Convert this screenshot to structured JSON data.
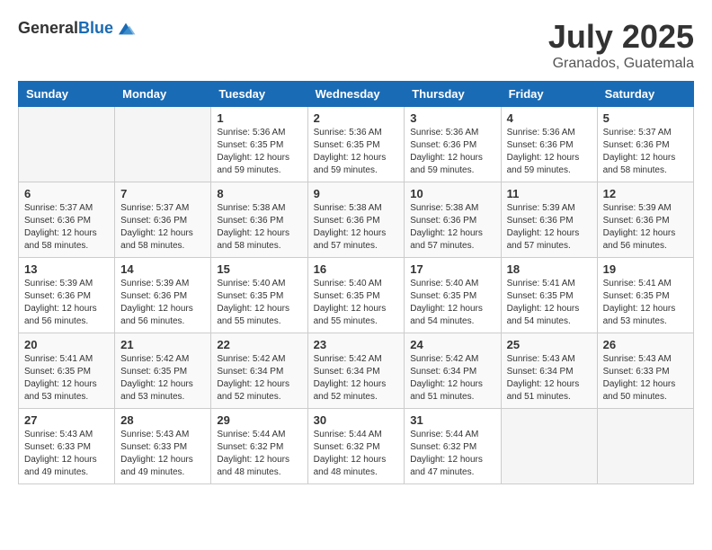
{
  "header": {
    "logo_general": "General",
    "logo_blue": "Blue",
    "month_title": "July 2025",
    "location": "Granados, Guatemala"
  },
  "weekdays": [
    "Sunday",
    "Monday",
    "Tuesday",
    "Wednesday",
    "Thursday",
    "Friday",
    "Saturday"
  ],
  "weeks": [
    [
      {
        "day": "",
        "sunrise": "",
        "sunset": "",
        "daylight": "",
        "empty": true
      },
      {
        "day": "",
        "sunrise": "",
        "sunset": "",
        "daylight": "",
        "empty": true
      },
      {
        "day": "1",
        "sunrise": "Sunrise: 5:36 AM",
        "sunset": "Sunset: 6:35 PM",
        "daylight": "Daylight: 12 hours and 59 minutes."
      },
      {
        "day": "2",
        "sunrise": "Sunrise: 5:36 AM",
        "sunset": "Sunset: 6:35 PM",
        "daylight": "Daylight: 12 hours and 59 minutes."
      },
      {
        "day": "3",
        "sunrise": "Sunrise: 5:36 AM",
        "sunset": "Sunset: 6:36 PM",
        "daylight": "Daylight: 12 hours and 59 minutes."
      },
      {
        "day": "4",
        "sunrise": "Sunrise: 5:36 AM",
        "sunset": "Sunset: 6:36 PM",
        "daylight": "Daylight: 12 hours and 59 minutes."
      },
      {
        "day": "5",
        "sunrise": "Sunrise: 5:37 AM",
        "sunset": "Sunset: 6:36 PM",
        "daylight": "Daylight: 12 hours and 58 minutes."
      }
    ],
    [
      {
        "day": "6",
        "sunrise": "Sunrise: 5:37 AM",
        "sunset": "Sunset: 6:36 PM",
        "daylight": "Daylight: 12 hours and 58 minutes."
      },
      {
        "day": "7",
        "sunrise": "Sunrise: 5:37 AM",
        "sunset": "Sunset: 6:36 PM",
        "daylight": "Daylight: 12 hours and 58 minutes."
      },
      {
        "day": "8",
        "sunrise": "Sunrise: 5:38 AM",
        "sunset": "Sunset: 6:36 PM",
        "daylight": "Daylight: 12 hours and 58 minutes."
      },
      {
        "day": "9",
        "sunrise": "Sunrise: 5:38 AM",
        "sunset": "Sunset: 6:36 PM",
        "daylight": "Daylight: 12 hours and 57 minutes."
      },
      {
        "day": "10",
        "sunrise": "Sunrise: 5:38 AM",
        "sunset": "Sunset: 6:36 PM",
        "daylight": "Daylight: 12 hours and 57 minutes."
      },
      {
        "day": "11",
        "sunrise": "Sunrise: 5:39 AM",
        "sunset": "Sunset: 6:36 PM",
        "daylight": "Daylight: 12 hours and 57 minutes."
      },
      {
        "day": "12",
        "sunrise": "Sunrise: 5:39 AM",
        "sunset": "Sunset: 6:36 PM",
        "daylight": "Daylight: 12 hours and 56 minutes."
      }
    ],
    [
      {
        "day": "13",
        "sunrise": "Sunrise: 5:39 AM",
        "sunset": "Sunset: 6:36 PM",
        "daylight": "Daylight: 12 hours and 56 minutes."
      },
      {
        "day": "14",
        "sunrise": "Sunrise: 5:39 AM",
        "sunset": "Sunset: 6:36 PM",
        "daylight": "Daylight: 12 hours and 56 minutes."
      },
      {
        "day": "15",
        "sunrise": "Sunrise: 5:40 AM",
        "sunset": "Sunset: 6:35 PM",
        "daylight": "Daylight: 12 hours and 55 minutes."
      },
      {
        "day": "16",
        "sunrise": "Sunrise: 5:40 AM",
        "sunset": "Sunset: 6:35 PM",
        "daylight": "Daylight: 12 hours and 55 minutes."
      },
      {
        "day": "17",
        "sunrise": "Sunrise: 5:40 AM",
        "sunset": "Sunset: 6:35 PM",
        "daylight": "Daylight: 12 hours and 54 minutes."
      },
      {
        "day": "18",
        "sunrise": "Sunrise: 5:41 AM",
        "sunset": "Sunset: 6:35 PM",
        "daylight": "Daylight: 12 hours and 54 minutes."
      },
      {
        "day": "19",
        "sunrise": "Sunrise: 5:41 AM",
        "sunset": "Sunset: 6:35 PM",
        "daylight": "Daylight: 12 hours and 53 minutes."
      }
    ],
    [
      {
        "day": "20",
        "sunrise": "Sunrise: 5:41 AM",
        "sunset": "Sunset: 6:35 PM",
        "daylight": "Daylight: 12 hours and 53 minutes."
      },
      {
        "day": "21",
        "sunrise": "Sunrise: 5:42 AM",
        "sunset": "Sunset: 6:35 PM",
        "daylight": "Daylight: 12 hours and 53 minutes."
      },
      {
        "day": "22",
        "sunrise": "Sunrise: 5:42 AM",
        "sunset": "Sunset: 6:34 PM",
        "daylight": "Daylight: 12 hours and 52 minutes."
      },
      {
        "day": "23",
        "sunrise": "Sunrise: 5:42 AM",
        "sunset": "Sunset: 6:34 PM",
        "daylight": "Daylight: 12 hours and 52 minutes."
      },
      {
        "day": "24",
        "sunrise": "Sunrise: 5:42 AM",
        "sunset": "Sunset: 6:34 PM",
        "daylight": "Daylight: 12 hours and 51 minutes."
      },
      {
        "day": "25",
        "sunrise": "Sunrise: 5:43 AM",
        "sunset": "Sunset: 6:34 PM",
        "daylight": "Daylight: 12 hours and 51 minutes."
      },
      {
        "day": "26",
        "sunrise": "Sunrise: 5:43 AM",
        "sunset": "Sunset: 6:33 PM",
        "daylight": "Daylight: 12 hours and 50 minutes."
      }
    ],
    [
      {
        "day": "27",
        "sunrise": "Sunrise: 5:43 AM",
        "sunset": "Sunset: 6:33 PM",
        "daylight": "Daylight: 12 hours and 49 minutes."
      },
      {
        "day": "28",
        "sunrise": "Sunrise: 5:43 AM",
        "sunset": "Sunset: 6:33 PM",
        "daylight": "Daylight: 12 hours and 49 minutes."
      },
      {
        "day": "29",
        "sunrise": "Sunrise: 5:44 AM",
        "sunset": "Sunset: 6:32 PM",
        "daylight": "Daylight: 12 hours and 48 minutes."
      },
      {
        "day": "30",
        "sunrise": "Sunrise: 5:44 AM",
        "sunset": "Sunset: 6:32 PM",
        "daylight": "Daylight: 12 hours and 48 minutes."
      },
      {
        "day": "31",
        "sunrise": "Sunrise: 5:44 AM",
        "sunset": "Sunset: 6:32 PM",
        "daylight": "Daylight: 12 hours and 47 minutes."
      },
      {
        "day": "",
        "sunrise": "",
        "sunset": "",
        "daylight": "",
        "empty": true
      },
      {
        "day": "",
        "sunrise": "",
        "sunset": "",
        "daylight": "",
        "empty": true
      }
    ]
  ]
}
